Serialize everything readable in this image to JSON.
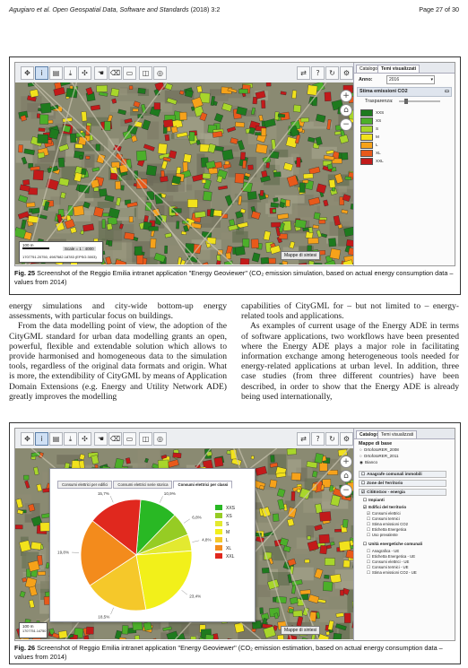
{
  "header": {
    "authors_journal": "Agugiaro et al. Open Geospatial Data, Software and Standards",
    "year_vol": "(2018) 3:2",
    "page": "Page 27 of 30"
  },
  "fig25": {
    "caption_label": "Fig. 25",
    "caption_text": "Screenshot of the Reggio Emilia intranet application \"Energy Geoviewer\" (CO₂ emission simulation, based on actual energy consumption data – values from 2014)",
    "panel": {
      "tab_catalog": "Catalogo",
      "tab_visible": "Temi visualizzati",
      "anno_label": "Anno:",
      "anno_value": "2016",
      "layer_name": "Stima emissioni CO2",
      "trasparenza_label": "Trasparenza:",
      "legend": [
        {
          "label": "XXS",
          "color": "#1e7a1e"
        },
        {
          "label": "XS",
          "color": "#4caf2a"
        },
        {
          "label": "S",
          "color": "#a8d62b"
        },
        {
          "label": "M",
          "color": "#f2e21c"
        },
        {
          "label": "L",
          "color": "#f6a21a"
        },
        {
          "label": "XL",
          "color": "#e8591a"
        },
        {
          "label": "XXL",
          "color": "#c21a1a"
        }
      ]
    },
    "scale": {
      "distance": "100 m",
      "scale_text": "Scale = 1 : 4000",
      "coords": "1707751.20750, 4987582.18783 (EPSG:3003)"
    },
    "mappe_button": "Mappe di sintesi"
  },
  "body": {
    "col1_p1": "energy simulations and city-wide bottom-up energy assessments, with particular focus on buildings.",
    "col1_p2": "From the data modelling point of view, the adoption of the CityGML standard for urban data modelling grants an open, powerful, flexible and extendable solution which allows to provide harmonised and homogeneous data to the simulation tools, regardless of the original data formats and origin. What is more, the extendibility of CityGML by means of Application Domain Extensions (e.g. Energy and Utility Network ADE) greatly improves the modelling",
    "col2_p1": "capabilities of CityGML for – but not limited to – energy-related tools and applications.",
    "col2_p2": "As examples of current usage of the Energy ADE in terms of software applications, two workflows have been presented where the Energy ADE plays a major role in facilitating information exchange among heterogeneous tools needed for energy-related applications at urban level. In addition, three case studies (from three different countries) have been described, in order to show that the Energy ADE is already being used internationally,"
  },
  "fig26": {
    "caption_label": "Fig. 26",
    "caption_text": "Screenshot of Reggio Emilia intranet application \"Energy Geoviewer\" (CO₂ emission estimation, based on actual energy consumption data – values from 2014)",
    "dialog_tabs": [
      "Consumi elettrici per edifici",
      "Consumi elettrici serie storica",
      "Consumi elettrici per classi"
    ],
    "panel": {
      "tab_catalog": "Catalogo",
      "tab_visible": "Temi visualizzati",
      "section_base": "Mappe di base",
      "base_maps": [
        "OrtofotoRER_2008",
        "OrtofotoRER_2011",
        "Bianco"
      ],
      "group_items": [
        "Anagrafe comunali immobili",
        "Zone del Territorio",
        "CitiEnGov - energia",
        "Impianti",
        "Edifici del territorio"
      ],
      "edifici_sub": [
        "Consumi elettrici",
        "Consumi termici",
        "Stima emissioni CO2",
        "Etichetta Energetica",
        "Uso prevalente"
      ],
      "unita_label": "Unità energetiche comunali",
      "unita_sub": [
        "Anagrafica - UE",
        "Etichetta Energetica - UE",
        "Consumi elettrici - UE",
        "Consumi termici - UE",
        "Stima emissioni CO2 - UE"
      ]
    },
    "mappe_button": "Mappe di sintesi",
    "scale_distance": "100 m",
    "coords_partial": "1707751.14750"
  },
  "chart_data": {
    "type": "pie",
    "categories": [
      "XXS",
      "XS",
      "S",
      "M",
      "L",
      "XL",
      "XXL"
    ],
    "values": [
      10.9,
      6.8,
      4.8,
      23.4,
      18.5,
      19.8,
      15.7
    ],
    "labels": [
      "10,9%",
      "6,8%",
      "4,8%",
      "23,4%",
      "18,5%",
      "19,8%",
      "15,7%"
    ],
    "colors": [
      "#29b824",
      "#96cc24",
      "#e3e930",
      "#f2f01a",
      "#f5c82a",
      "#f38b1c",
      "#e0281e"
    ],
    "legend_position": "right"
  }
}
